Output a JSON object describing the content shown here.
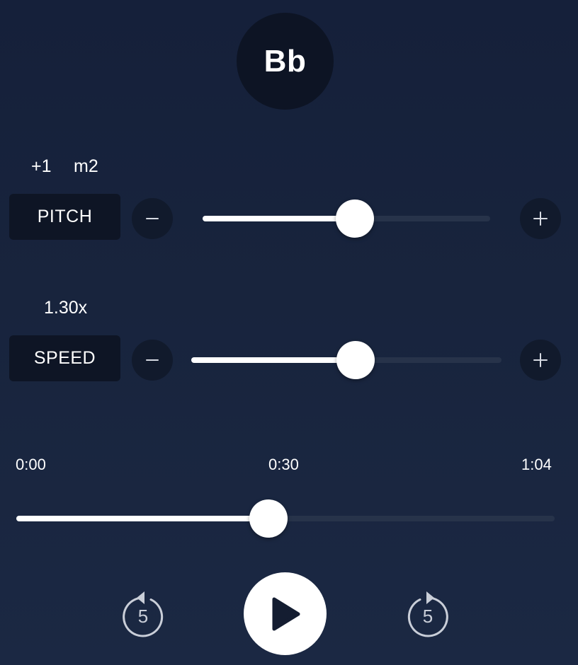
{
  "key": {
    "name": "Bb"
  },
  "pitch": {
    "semitones_text": "+1",
    "interval_text": "m2",
    "label": "PITCH",
    "decrease_icon": "minus-icon",
    "increase_icon": "plus-icon",
    "value_fraction": 0.53
  },
  "speed": {
    "value_text": "1.30x",
    "label": "SPEED",
    "decrease_icon": "minus-icon",
    "increase_icon": "plus-icon",
    "value_fraction": 0.53
  },
  "playback": {
    "start_time": "0:00",
    "current_time": "0:30",
    "end_time": "1:04",
    "progress_fraction": 0.468
  },
  "transport": {
    "rewind_seconds": "5",
    "forward_seconds": "5",
    "play_icon": "play-icon",
    "rewind_icon": "rewind-5-icon",
    "forward_icon": "forward-5-icon"
  },
  "colors": {
    "background": "#18243d",
    "panel": "#0e1525",
    "track": "#27334a",
    "accent": "#ffffff"
  }
}
